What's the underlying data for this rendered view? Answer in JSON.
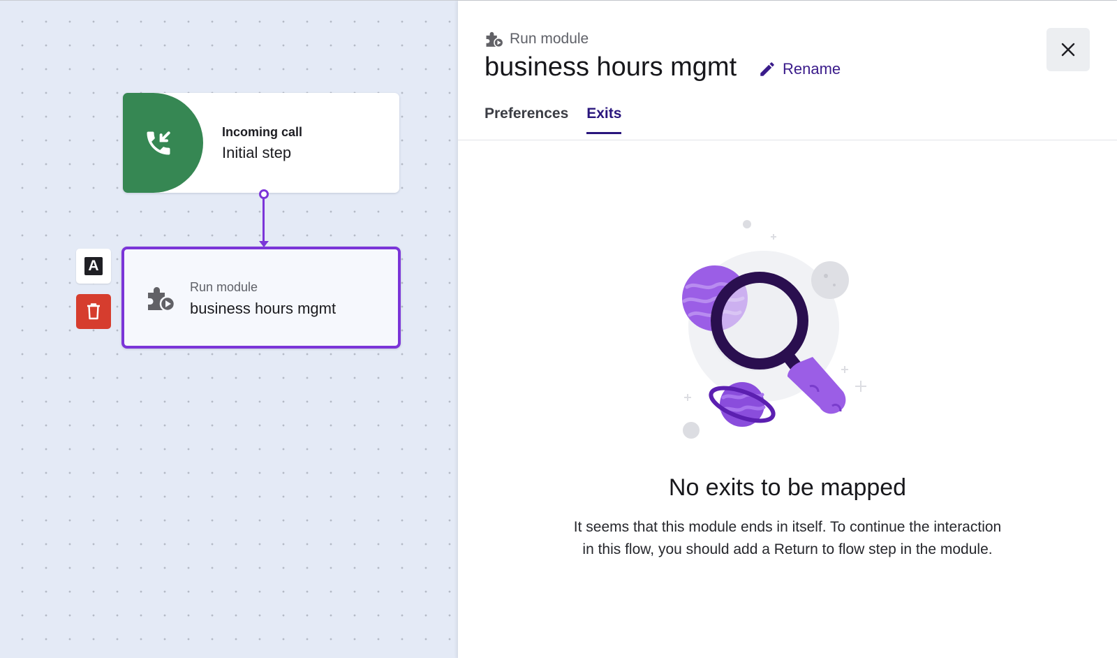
{
  "canvas": {
    "initial_node": {
      "type_label": "Incoming call",
      "name": "Initial step",
      "icon": "incoming-call-icon"
    },
    "module_node": {
      "type_label": "Run module",
      "name": "business hours mgmt",
      "icon": "run-module-icon"
    },
    "side_actions": {
      "label_button": "A",
      "delete_icon": "trash-icon"
    }
  },
  "panel": {
    "kind_label": "Run module",
    "title": "business hours mgmt",
    "rename_label": "Rename",
    "close_icon": "close-icon",
    "tabs": [
      {
        "label": "Preferences",
        "active": false
      },
      {
        "label": "Exits",
        "active": true
      }
    ],
    "empty_state": {
      "title": "No exits to be mapped",
      "line1": "It seems that this module ends in itself. To continue the interaction",
      "line2": "in this flow, you should add a Return to flow step in the module."
    }
  },
  "colors": {
    "accent_purple": "#7b35d8",
    "tab_active": "#2a167d",
    "green": "#368753",
    "delete_red": "#d63d2e",
    "canvas_bg": "#e4eaf6"
  }
}
